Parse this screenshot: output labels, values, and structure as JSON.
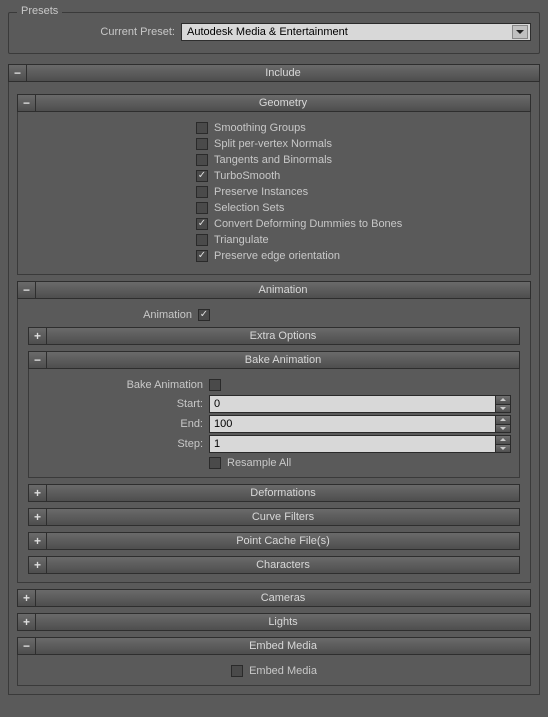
{
  "presets": {
    "legend": "Presets",
    "current_preset_label": "Current Preset:",
    "current_preset_value": "Autodesk Media & Entertainment"
  },
  "include": {
    "title": "Include",
    "geometry": {
      "title": "Geometry",
      "items": [
        {
          "label": "Smoothing Groups",
          "checked": false
        },
        {
          "label": "Split per-vertex Normals",
          "checked": false
        },
        {
          "label": "Tangents and Binormals",
          "checked": false
        },
        {
          "label": "TurboSmooth",
          "checked": true
        },
        {
          "label": "Preserve Instances",
          "checked": false
        },
        {
          "label": "Selection Sets",
          "checked": false
        },
        {
          "label": "Convert Deforming Dummies to Bones",
          "checked": true
        },
        {
          "label": "Triangulate",
          "checked": false
        },
        {
          "label": "Preserve edge orientation",
          "checked": true
        }
      ]
    },
    "animation": {
      "title": "Animation",
      "animation_label": "Animation",
      "animation_checked": true,
      "extra_options": {
        "title": "Extra Options"
      },
      "bake": {
        "title": "Bake Animation",
        "bake_label": "Bake Animation",
        "bake_checked": false,
        "start_label": "Start:",
        "start_value": "0",
        "end_label": "End:",
        "end_value": "100",
        "step_label": "Step:",
        "step_value": "1",
        "resample_label": "Resample All",
        "resample_checked": false
      },
      "deformations": {
        "title": "Deformations"
      },
      "curve_filters": {
        "title": "Curve Filters"
      },
      "point_cache": {
        "title": "Point Cache File(s)"
      },
      "characters": {
        "title": "Characters"
      }
    },
    "cameras": {
      "title": "Cameras"
    },
    "lights": {
      "title": "Lights"
    },
    "embed": {
      "title": "Embed Media",
      "label": "Embed Media",
      "checked": false
    }
  }
}
